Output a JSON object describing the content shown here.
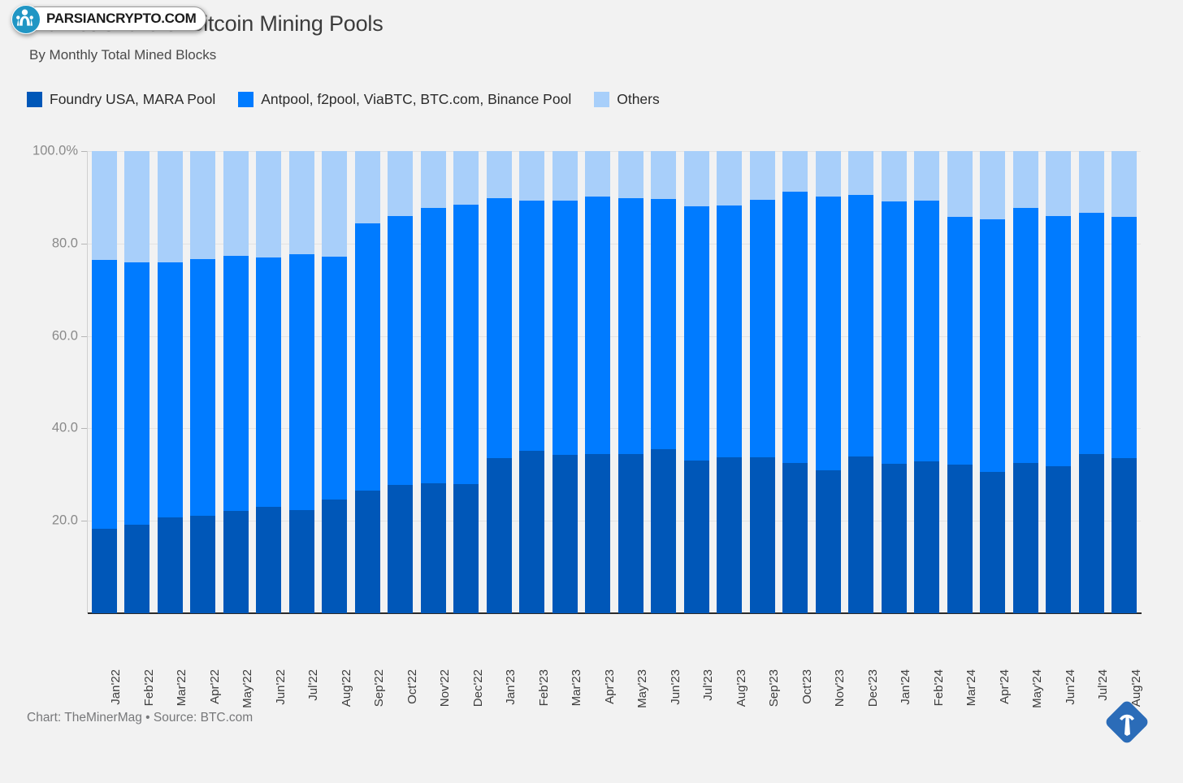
{
  "header": {
    "title": "Market Share of Bitcoin Mining Pools",
    "subtitle": "By Monthly Total Mined Blocks"
  },
  "watermark": {
    "text": "PARSIANCRYPTO.COM",
    "logo_icon": "parsiancrypto-logo-icon",
    "circle_color": "#2196c4"
  },
  "footer": {
    "credit": "Chart: TheMinerMag • Source: BTC.com",
    "logo_icon": "theminermag-pickaxe-logo-icon",
    "logo_color": "#2b6cb8"
  },
  "colors": {
    "background": "#f2f2f2",
    "foundry": "#0057b8",
    "antpool": "#007bff",
    "others": "#a8cffa",
    "gridline": "#e3e3e3",
    "axis": "#2b2b2b",
    "tick_text": "#8a8a8a"
  },
  "chart_data": {
    "type": "bar",
    "title": "Market Share of Bitcoin Mining Pools",
    "subtitle": "By Monthly Total Mined Blocks",
    "stacked": true,
    "stack_mode": "percent",
    "xlabel": "",
    "ylabel": "",
    "ylim": [
      0,
      100
    ],
    "grid": true,
    "legend_position": "top-left",
    "y_ticks": [
      0,
      20,
      40,
      60,
      80,
      100
    ],
    "y_tick_labels": [
      "",
      "20.0",
      "40.0",
      "60.0",
      "80.0",
      "100.0%"
    ],
    "categories": [
      "Jan'22",
      "Feb'22",
      "Mar'22",
      "Apr'22",
      "May'22",
      "Jun'22",
      "Jul'22",
      "Aug'22",
      "Sep'22",
      "Oct'22",
      "Nov'22",
      "Dec'22",
      "Jan'23",
      "Feb'23",
      "Mar'23",
      "Apr'23",
      "May'23",
      "Jun'23",
      "Jul'23",
      "Aug'23",
      "Sep'23",
      "Oct'23",
      "Nov'23",
      "Dec'23",
      "Jan'24",
      "Feb'24",
      "Mar'24",
      "Apr'24",
      "May'24",
      "Jun'24",
      "Jul'24",
      "Aug'24"
    ],
    "series": [
      {
        "name": "Foundry USA, MARA Pool",
        "color": "#0057b8",
        "values": [
          18.2,
          19.2,
          20.8,
          21.1,
          22.1,
          23.1,
          22.3,
          24.6,
          26.5,
          27.8,
          28.2,
          28.0,
          33.6,
          35.1,
          34.2,
          34.5,
          34.5,
          35.5,
          33.1,
          33.7,
          33.7,
          32.5,
          31.0,
          34.0,
          32.3,
          32.8,
          32.2,
          30.5,
          32.6,
          31.8,
          34.4,
          33.6
        ]
      },
      {
        "name": "Antpool, f2pool, ViaBTC, BTC.com, Binance Pool",
        "color": "#007bff",
        "values": [
          58.3,
          56.8,
          55.2,
          55.5,
          55.3,
          53.9,
          55.4,
          52.6,
          57.9,
          58.1,
          59.5,
          60.4,
          56.2,
          54.1,
          55.1,
          55.7,
          55.3,
          54.2,
          55.0,
          54.6,
          55.8,
          58.7,
          59.1,
          56.5,
          56.8,
          56.5,
          53.6,
          54.7,
          55.1,
          54.1,
          52.2,
          52.1
        ]
      },
      {
        "name": "Others",
        "color": "#a8cffa",
        "values": [
          23.5,
          24.0,
          24.0,
          23.4,
          22.6,
          23.0,
          22.3,
          22.8,
          15.6,
          14.1,
          12.3,
          11.6,
          10.2,
          10.8,
          10.7,
          9.8,
          10.2,
          10.3,
          11.9,
          11.7,
          10.5,
          8.8,
          9.9,
          9.5,
          10.9,
          10.7,
          14.2,
          14.8,
          12.3,
          14.1,
          13.4,
          14.3
        ]
      }
    ],
    "stack_tops": {
      "foundry_plus_antpool": [
        76.5,
        76.0,
        76.0,
        76.6,
        77.4,
        77.0,
        77.7,
        77.2,
        84.4,
        85.9,
        87.7,
        88.4,
        89.8,
        89.2,
        89.3,
        90.2,
        89.8,
        89.7,
        88.1,
        88.3,
        89.5,
        91.2,
        90.1,
        90.5,
        89.1,
        89.3,
        85.8,
        85.2,
        87.7,
        85.9,
        86.6,
        85.7
      ]
    }
  }
}
